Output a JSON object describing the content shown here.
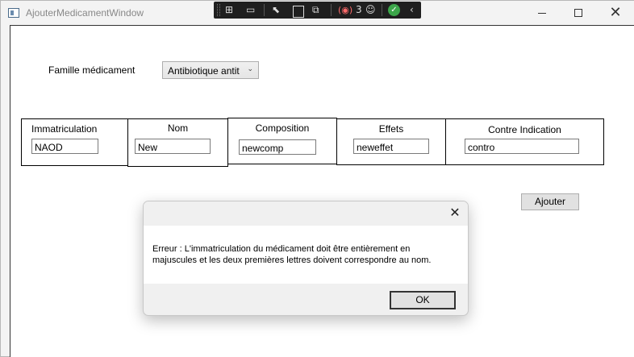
{
  "window": {
    "title": "AjouterMedicamentWindow"
  },
  "devtools": {
    "live_count": "3"
  },
  "form": {
    "famille_label": "Famille médicament",
    "famille_value": "Antibiotique antit",
    "ajouter_label": "Ajouter",
    "fields": [
      {
        "label": "Immatriculation",
        "value": "NAOD"
      },
      {
        "label": "Nom",
        "value": "New"
      },
      {
        "label": "Composition",
        "value": "newcomp"
      },
      {
        "label": "Effets",
        "value": "neweffet"
      },
      {
        "label": "Contre Indication",
        "value": "contro"
      }
    ]
  },
  "dialog": {
    "message_line1": "Erreur : L'immatriculation du médicament doit être entièrement en",
    "message_line2": "majuscules et les deux premières lettres doivent correspondre au nom.",
    "ok_label": "OK"
  }
}
